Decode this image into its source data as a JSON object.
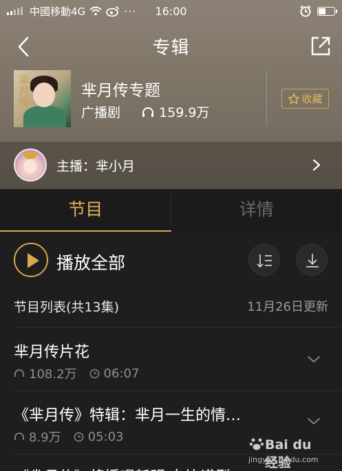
{
  "status_bar": {
    "carrier": "中國移動4G",
    "time": "16:00",
    "battery_level": 0.4
  },
  "nav": {
    "title": "专辑",
    "back_icon": "chevron-left-icon",
    "share_icon": "share-out-icon"
  },
  "album": {
    "title": "芈月传专题",
    "category": "广播剧",
    "plays": "159.9万",
    "cover_text": "芈月传",
    "collect_label": "收藏",
    "collect_icon": "star-outline-icon"
  },
  "host": {
    "label": "主播：芈小月"
  },
  "tabs": [
    {
      "label": "节目",
      "active": true
    },
    {
      "label": "详情",
      "active": false
    }
  ],
  "play_all": {
    "label": "播放全部"
  },
  "list_header": {
    "count_text": "节目列表(共13集)",
    "updated_text": "11月26日更新"
  },
  "episodes": [
    {
      "title": "芈月传片花",
      "plays": "108.2万",
      "duration": "06:07"
    },
    {
      "title": "《芈月传》特辑：芈月一生的情…",
      "plays": "8.9万",
      "duration": "05:03"
    },
    {
      "title": "《芈月传》将播喝新明 女饮诺型",
      "plays": "",
      "duration": ""
    }
  ],
  "watermark": {
    "brand": "Bai du 经验",
    "url": "jingyan.baidu.com"
  },
  "colors": {
    "accent": "#d9a84f",
    "background": "#1e1e1e",
    "header_bg": "#7d7466"
  }
}
